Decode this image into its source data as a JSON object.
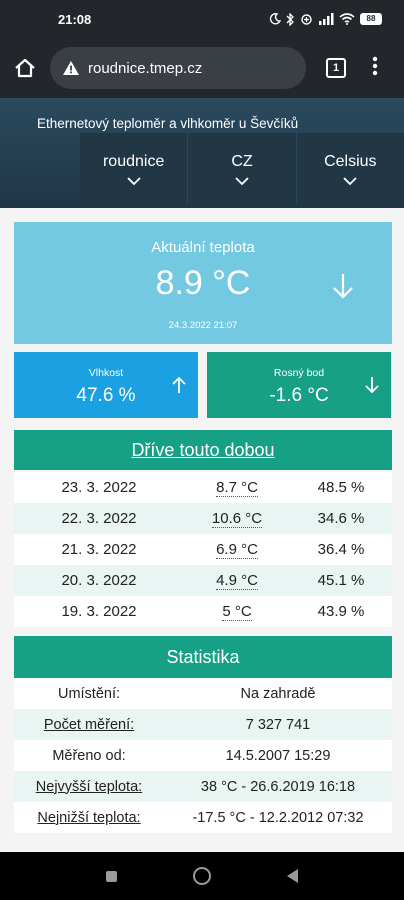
{
  "status": {
    "time": "21:08",
    "battery": "88"
  },
  "browser": {
    "url": "roudnice.tmep.cz",
    "tab_count": "1"
  },
  "header": {
    "title": "Ethernetový teploměr a vlhkoměr u Ševčíků",
    "nav": [
      {
        "label": "roudnice"
      },
      {
        "label": "CZ"
      },
      {
        "label": "Celsius"
      }
    ]
  },
  "current": {
    "label": "Aktuální teplota",
    "value": "8.9 °C",
    "timestamp": "24.3.2022 21:07",
    "trend": "down"
  },
  "humidity": {
    "label": "Vlhkost",
    "value": "47.6 %",
    "trend": "up"
  },
  "dewpoint": {
    "label": "Rosný bod",
    "value": "-1.6 °C",
    "trend": "down"
  },
  "history": {
    "title": "Dříve touto dobou",
    "rows": [
      {
        "date": "23. 3. 2022",
        "temp": "8.7 °C",
        "hum": "48.5 %"
      },
      {
        "date": "22. 3. 2022",
        "temp": "10.6 °C",
        "hum": "34.6 %"
      },
      {
        "date": "21. 3. 2022",
        "temp": "6.9 °C",
        "hum": "36.4 %"
      },
      {
        "date": "20. 3. 2022",
        "temp": "4.9 °C",
        "hum": "45.1 %"
      },
      {
        "date": "19. 3. 2022",
        "temp": "5 °C",
        "hum": "43.9 %"
      }
    ]
  },
  "stats": {
    "title": "Statistika",
    "rows": [
      {
        "key": "Umístění:",
        "value": "Na zahradě"
      },
      {
        "key": "Počet měření:",
        "value": "7 327 741"
      },
      {
        "key": "Měřeno od:",
        "value": "14.5.2007 15:29"
      },
      {
        "key": "Nejvyšší teplota:",
        "value": "38 °C - 26.6.2019 16:18"
      },
      {
        "key": "Nejnižší teplota:",
        "value": "-17.5 °C - 12.2.2012 07:32"
      }
    ]
  }
}
